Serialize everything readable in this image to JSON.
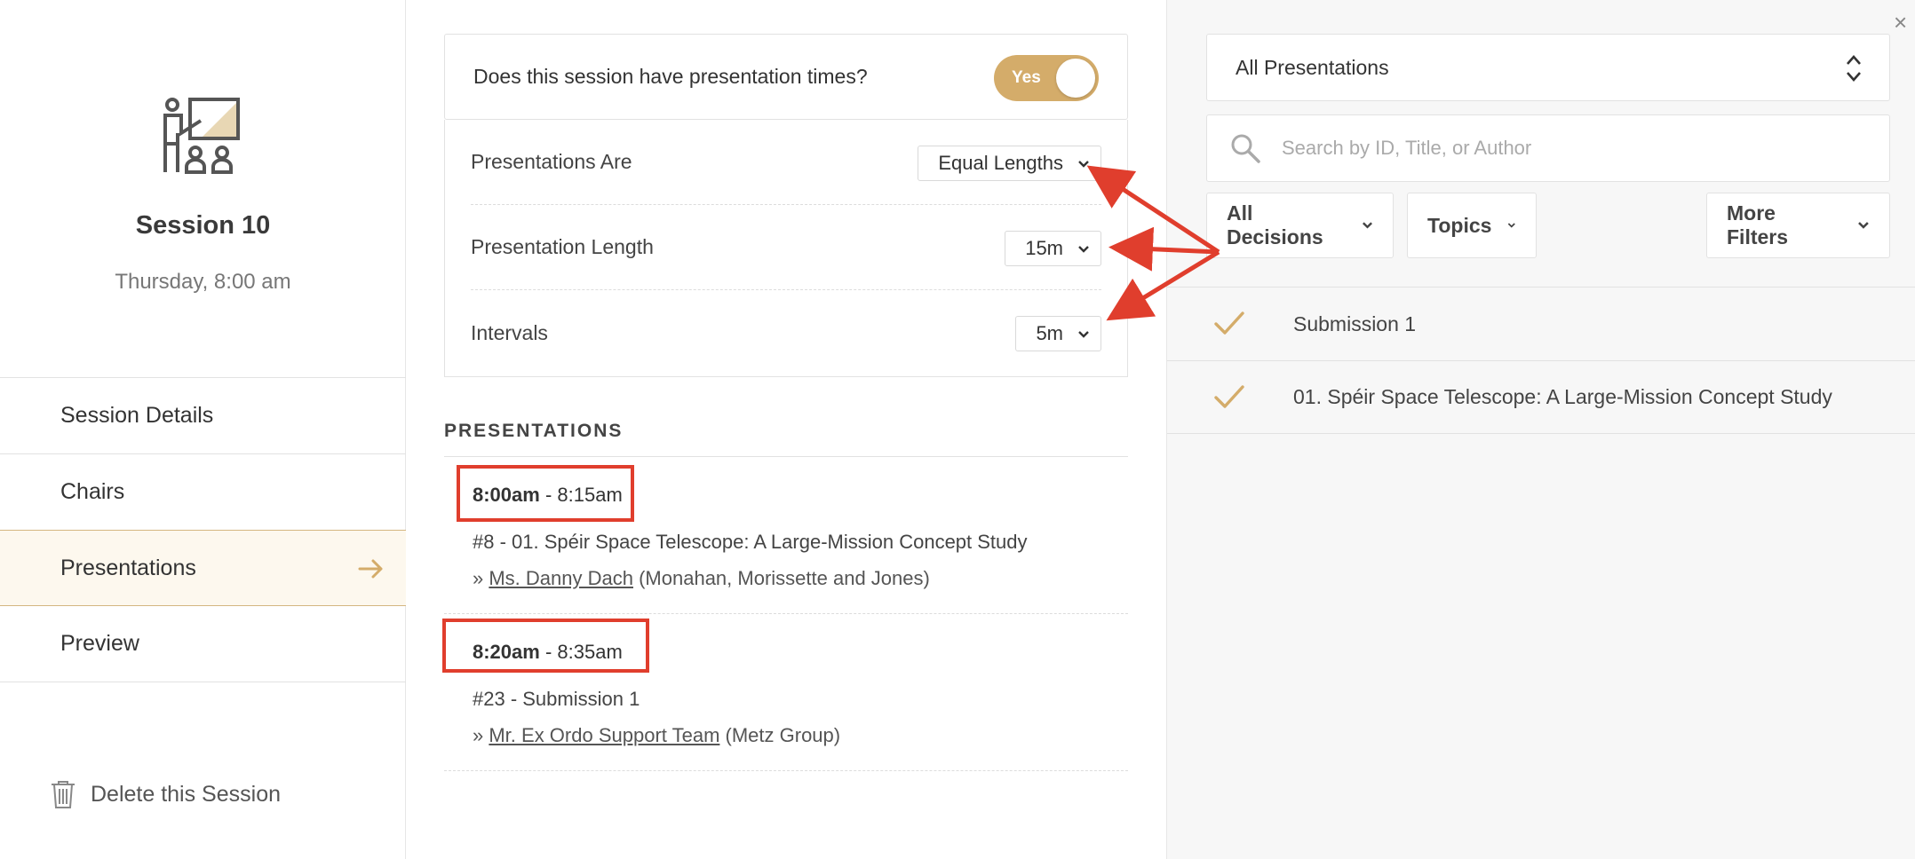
{
  "sidebar": {
    "session_title": "Session 10",
    "session_time": "Thursday, 8:00 am",
    "nav": [
      {
        "label": "Session Details"
      },
      {
        "label": "Chairs"
      },
      {
        "label": "Presentations",
        "active": true
      },
      {
        "label": "Preview"
      }
    ],
    "delete_label": "Delete this Session"
  },
  "middle": {
    "question": "Does this session have presentation times?",
    "toggle_label": "Yes",
    "settings": [
      {
        "label": "Presentations Are",
        "value": "Equal Lengths"
      },
      {
        "label": "Presentation Length",
        "value": "15m"
      },
      {
        "label": "Intervals",
        "value": "5m"
      }
    ],
    "presentations_heading": "PRESENTATIONS",
    "presentations": [
      {
        "start": "8:00am",
        "end": " - 8:15am",
        "title": "#8 - 01. Spéir Space Telescope: A Large-Mission Concept Study",
        "prefix": "» ",
        "author": "Ms. Danny Dach",
        "org": " (Monahan, Morissette and Jones)"
      },
      {
        "start": "8:20am",
        "end": " - 8:35am",
        "title": "#23 - Submission 1",
        "prefix": "» ",
        "author": "Mr. Ex Ordo Support Team",
        "org": " (Metz Group)"
      }
    ]
  },
  "right": {
    "close_label": "×",
    "all_presentations": "All Presentations",
    "search_placeholder": "Search by ID, Title, or Author",
    "filters": {
      "decisions": "All Decisions",
      "topics": "Topics",
      "more": "More Filters"
    },
    "results": [
      {
        "label": "Submission 1"
      },
      {
        "label": "01. Spéir Space Telescope: A Large-Mission Concept Study"
      }
    ]
  },
  "colors": {
    "accent": "#d4ac6a",
    "annotation_red": "#e03e2d",
    "active_nav_bg": "#fdf8ee"
  }
}
